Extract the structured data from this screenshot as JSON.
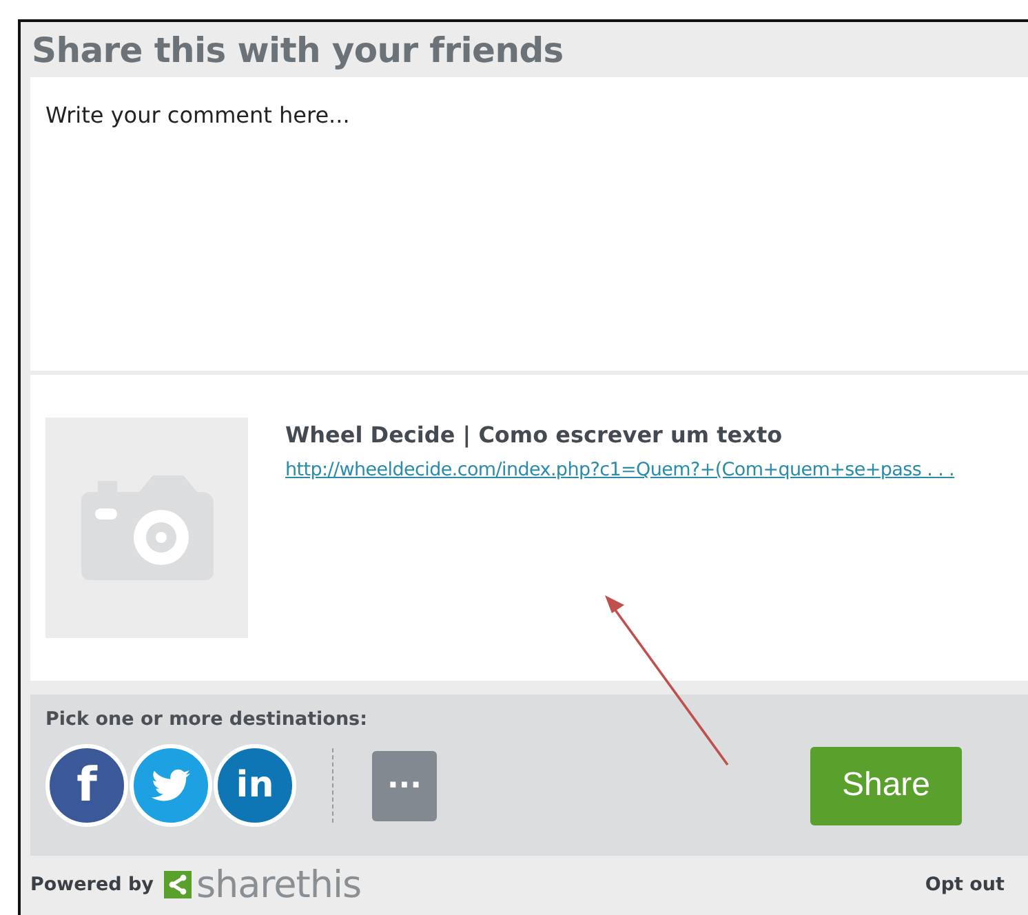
{
  "title": "Share this with your friends",
  "comment": {
    "placeholder": "Write your comment here..."
  },
  "preview": {
    "title": "Wheel Decide | Como escrever um texto",
    "url": "http://wheeldecide.com/index.php?c1=Quem?+(Com+quem+se+pass . . ."
  },
  "destinations": {
    "label": "Pick one or more destinations:",
    "services": [
      {
        "kind": "facebook",
        "label": "f"
      },
      {
        "kind": "twitter"
      },
      {
        "kind": "linkedin",
        "label": "in"
      }
    ],
    "more": "···",
    "share": "Share"
  },
  "footer": {
    "powered_by": "Powered by",
    "logo": "sharethis",
    "opt_out": "Opt out"
  }
}
